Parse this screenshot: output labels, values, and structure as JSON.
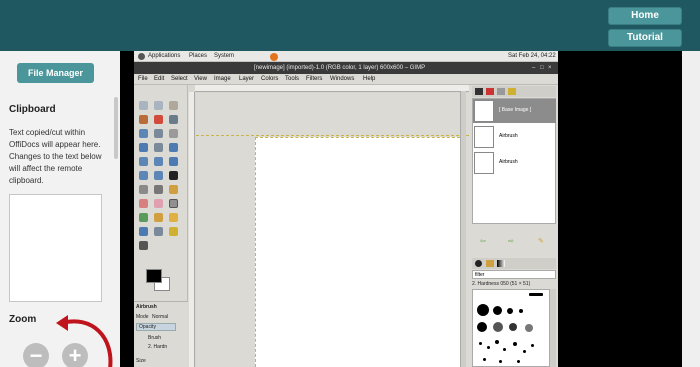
{
  "header": {
    "home_label": "Home",
    "tutorial_label": "Tutorial"
  },
  "sidebar": {
    "file_manager_label": "File Manager",
    "clipboard_title": "Clipboard",
    "clipboard_desc": "Text copied/cut within OffiDocs will appear here. Changes to the text below will affect the remote clipboard.",
    "clipboard_value": "",
    "zoom_title": "Zoom",
    "zoom_out_label": "−",
    "zoom_in_label": "+"
  },
  "gnome": {
    "applications": "Applications",
    "places": "Places",
    "system": "System",
    "clock": "Sat Feb 24, 04:22"
  },
  "gimp": {
    "title": "[newimage] (imported)-1.0 (RGB color, 1 layer) 600x600 – GIMP",
    "menus": [
      "File",
      "Edit",
      "Select",
      "View",
      "Image",
      "Layer",
      "Colors",
      "Tools",
      "Filters",
      "Windows",
      "Help"
    ],
    "layers": [
      {
        "name": "[ Base Image ]",
        "selected": true
      },
      {
        "name": "Airbrush",
        "selected": false
      },
      {
        "name": "Airbrush",
        "selected": false
      }
    ],
    "tool_options": {
      "title": "Airbrush",
      "mode_label": "Mode",
      "mode_value": "Normal",
      "opacity_label": "Opacity",
      "brush_label": "Brush",
      "brush_value": "2. Hardn",
      "size_label": "Size"
    },
    "brushes": {
      "filter": "filter",
      "current": "2. Hardness 050 (51 × 51)"
    }
  },
  "colors": {
    "header_bg": "#1f5860",
    "button_bg": "#4a969a",
    "arrow": "#c0141c"
  }
}
